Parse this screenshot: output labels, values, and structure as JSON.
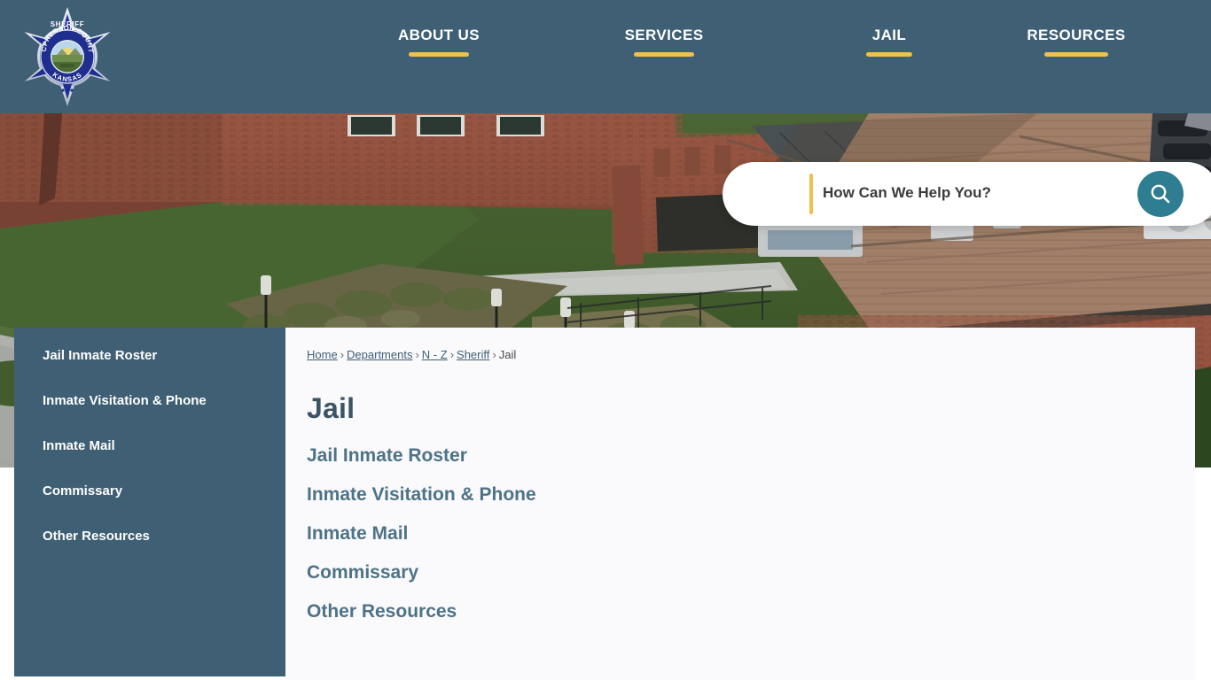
{
  "header": {
    "logo": {
      "icon": "sheriff-star-badge-icon",
      "top_text": "SHERIFF",
      "ring_text": "MCPHERSON COUNTY",
      "bottom_text": "KANSAS"
    },
    "nav_items": [
      {
        "label": "ABOUT US"
      },
      {
        "label": "SERVICES"
      },
      {
        "label": "JAIL"
      },
      {
        "label": "RESOURCES"
      }
    ],
    "colors": {
      "background": "#3e5f74",
      "underline": "#f0c04a",
      "label": "#ffffff"
    }
  },
  "hero": {
    "description": "Aerial photo of red brick county jail and courthouse building with lawn, sidewalks and landscaping",
    "search": {
      "facebook_icon": "facebook-icon",
      "placeholder": "How Can We Help You?",
      "value": "",
      "search_icon": "search-icon",
      "button_color": "#2f7d91",
      "divider_color": "#f0c04a"
    }
  },
  "sidebar": {
    "items": [
      {
        "label": "Jail Inmate Roster"
      },
      {
        "label": "Inmate Visitation & Phone"
      },
      {
        "label": "Inmate Mail"
      },
      {
        "label": "Commissary"
      },
      {
        "label": "Other Resources"
      }
    ],
    "background": "#3e5f74"
  },
  "main": {
    "breadcrumb": {
      "links": [
        {
          "label": "Home"
        },
        {
          "label": "Departments"
        },
        {
          "label": "N - Z"
        },
        {
          "label": "Sheriff"
        }
      ],
      "current": "Jail",
      "separator": "›"
    },
    "title": "Jail",
    "links": [
      {
        "label": "Jail Inmate Roster"
      },
      {
        "label": "Inmate Visitation & Phone"
      },
      {
        "label": "Inmate Mail"
      },
      {
        "label": "Commissary"
      },
      {
        "label": "Other Resources"
      }
    ],
    "link_color": "#4d7387",
    "background": "#faf9fc"
  }
}
